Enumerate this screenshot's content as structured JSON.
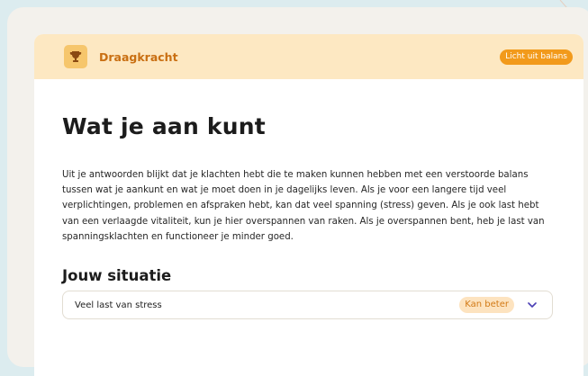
{
  "header": {
    "icon": "trophy-icon",
    "title": "Draagkracht",
    "badge": "Licht uit balans"
  },
  "main": {
    "title": "Wat je aan kunt",
    "intro": "Uit je antwoorden blijkt dat je klachten hebt die te maken kunnen hebben met een verstoorde balans tussen wat je aankunt en wat je moet doen in je dagelijks leven. Als je voor een langere tijd veel verplichtingen, problemen en afspraken hebt, kan dat veel spanning (stress) geven. Als je ook last hebt van een verlaagde vitaliteit, kun je hier overspannen van raken. Als je overspannen bent, heb je last van spanningsklachten en functioneer je minder goed."
  },
  "situation": {
    "title": "Jouw situatie",
    "items": [
      {
        "label": "Veel last van stress",
        "status": "Kan beter",
        "icon": "chevron-down-icon"
      }
    ]
  },
  "colors": {
    "header_bg": "#fde8c2",
    "accent": "#f29a1b",
    "title_orange": "#c96f12",
    "chevron": "#4b3fb5"
  }
}
